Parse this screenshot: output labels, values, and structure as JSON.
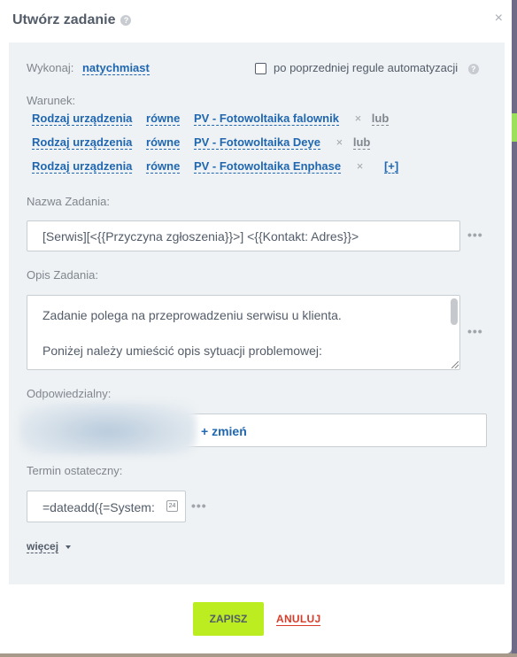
{
  "dialog": {
    "title": "Utwórz zadanie",
    "help_glyph": "?",
    "close_glyph": "×"
  },
  "execute": {
    "label": "Wykonaj:",
    "value": "natychmiast",
    "checkbox_label": "po poprzedniej regule automatyzacji",
    "help_glyph": "?"
  },
  "condition": {
    "label": "Warunek:",
    "rows": [
      {
        "field": "Rodzaj urządzenia",
        "operator": "równe",
        "value": "PV - Fotowoltaika falownik",
        "remove": "×",
        "joiner": "lub"
      },
      {
        "field": "Rodzaj urządzenia",
        "operator": "równe",
        "value": "PV - Fotowoltaika Deye",
        "remove": "×",
        "joiner": "lub"
      },
      {
        "field": "Rodzaj urządzenia",
        "operator": "równe",
        "value": "PV - Fotowoltaika Enphase",
        "remove": "×",
        "add": "[+]"
      }
    ]
  },
  "task_name": {
    "label": "Nazwa Zadania:",
    "value": "[Serwis][<{{Przyczyna zgłoszenia}}>] <{{Kontakt: Adres}}>"
  },
  "task_desc": {
    "label": "Opis Zadania:",
    "line1": "Zadanie polega na przeprowadzeniu serwisu u klienta.",
    "line2": "Poniżej należy umieścić opis sytuacji problemowej:"
  },
  "responsible": {
    "label": "Odpowiedzialny:",
    "change": "+ zmień"
  },
  "deadline": {
    "label": "Termin ostateczny:",
    "value": "=dateadd({=System:",
    "cal_text": "24"
  },
  "more": {
    "label": "więcej"
  },
  "actions": {
    "save": "ZAPISZ",
    "cancel": "ANULUJ"
  },
  "more_glyph": "•••",
  "colors": {
    "accent": "#bbed21",
    "link": "#2067b0",
    "danger": "#d63c2a",
    "panel": "#eef2f4"
  }
}
